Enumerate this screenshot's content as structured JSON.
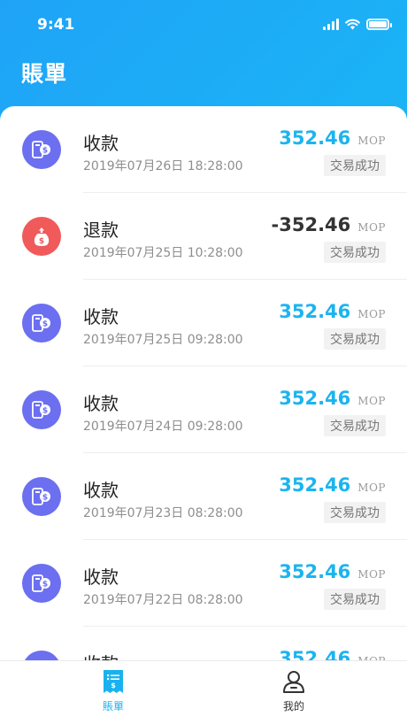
{
  "status_bar": {
    "time": "9:41"
  },
  "header": {
    "title": "賬單"
  },
  "colors": {
    "income_amount": "#1cb4ee",
    "refund_amount": "#333333",
    "income_icon_bg": "#6b6ff0",
    "refund_icon_bg": "#f05a5a",
    "tab_active": "#1ab2ee",
    "tab_inactive": "#333333"
  },
  "transactions": [
    {
      "type": "收款",
      "date": "2019年07月26日 18:28:00",
      "amount": "352.46",
      "currency": "MOP",
      "status": "交易成功",
      "icon": "receive-payment-icon"
    },
    {
      "type": "退款",
      "date": "2019年07月25日 10:28:00",
      "amount": "-352.46",
      "currency": "MOP",
      "status": "交易成功",
      "icon": "refund-icon"
    },
    {
      "type": "收款",
      "date": "2019年07月25日 09:28:00",
      "amount": "352.46",
      "currency": "MOP",
      "status": "交易成功",
      "icon": "receive-payment-icon"
    },
    {
      "type": "收款",
      "date": "2019年07月24日 09:28:00",
      "amount": "352.46",
      "currency": "MOP",
      "status": "交易成功",
      "icon": "receive-payment-icon"
    },
    {
      "type": "收款",
      "date": "2019年07月23日 08:28:00",
      "amount": "352.46",
      "currency": "MOP",
      "status": "交易成功",
      "icon": "receive-payment-icon"
    },
    {
      "type": "收款",
      "date": "2019年07月22日 08:28:00",
      "amount": "352.46",
      "currency": "MOP",
      "status": "交易成功",
      "icon": "receive-payment-icon"
    },
    {
      "type": "收款",
      "date": "",
      "amount": "352.46",
      "currency": "MOP",
      "status": "",
      "icon": "receive-payment-icon"
    }
  ],
  "tabbar": {
    "tabs": [
      {
        "label": "賬單",
        "icon": "bill-icon",
        "active": true
      },
      {
        "label": "我的",
        "icon": "user-icon",
        "active": false
      }
    ]
  }
}
